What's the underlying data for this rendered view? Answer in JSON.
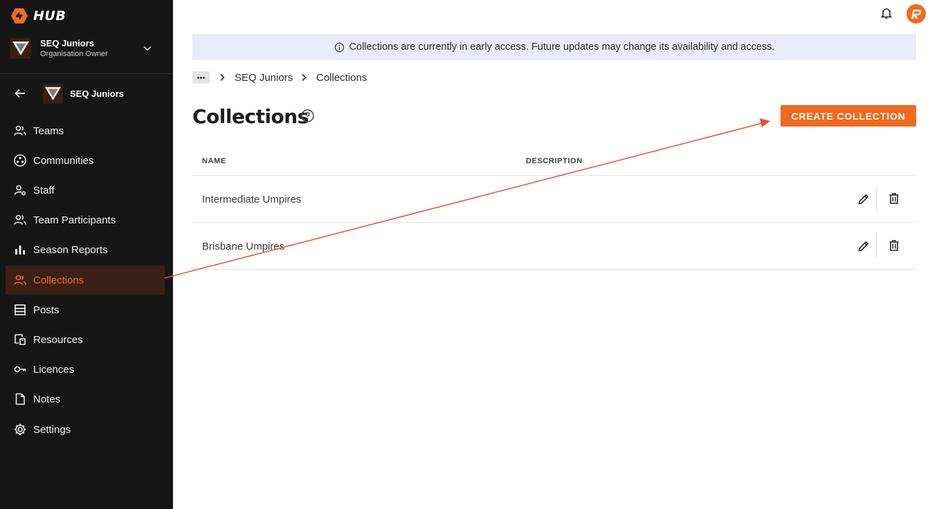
{
  "brand": {
    "name": "HUB",
    "accent": "#f26a1f"
  },
  "org": {
    "name": "SEQ Juniors",
    "role": "Organisation Owner"
  },
  "context": {
    "name": "SEQ Juniors"
  },
  "nav": [
    {
      "label": "Teams",
      "icon": "people-icon"
    },
    {
      "label": "Communities",
      "icon": "communities-icon"
    },
    {
      "label": "Staff",
      "icon": "staff-icon"
    },
    {
      "label": "Team Participants",
      "icon": "people-icon"
    },
    {
      "label": "Season Reports",
      "icon": "bar-chart-icon"
    },
    {
      "label": "Collections",
      "icon": "people-icon",
      "active": true
    },
    {
      "label": "Posts",
      "icon": "posts-icon"
    },
    {
      "label": "Resources",
      "icon": "resources-icon"
    },
    {
      "label": "Licences",
      "icon": "key-icon"
    },
    {
      "label": "Notes",
      "icon": "file-icon"
    },
    {
      "label": "Settings",
      "icon": "gear-icon"
    }
  ],
  "banner": {
    "text": "Collections are currently in early access. Future updates may change its availability and access."
  },
  "breadcrumb": {
    "items": [
      "SEQ Juniors",
      "Collections"
    ]
  },
  "page": {
    "title": "Collections",
    "create_label": "CREATE COLLECTION"
  },
  "table": {
    "headers": {
      "name": "NAME",
      "description": "DESCRIPTION"
    },
    "rows": [
      {
        "name": "Intermediate Umpires",
        "description": ""
      },
      {
        "name": "Brisbane Umpires",
        "description": ""
      }
    ]
  }
}
